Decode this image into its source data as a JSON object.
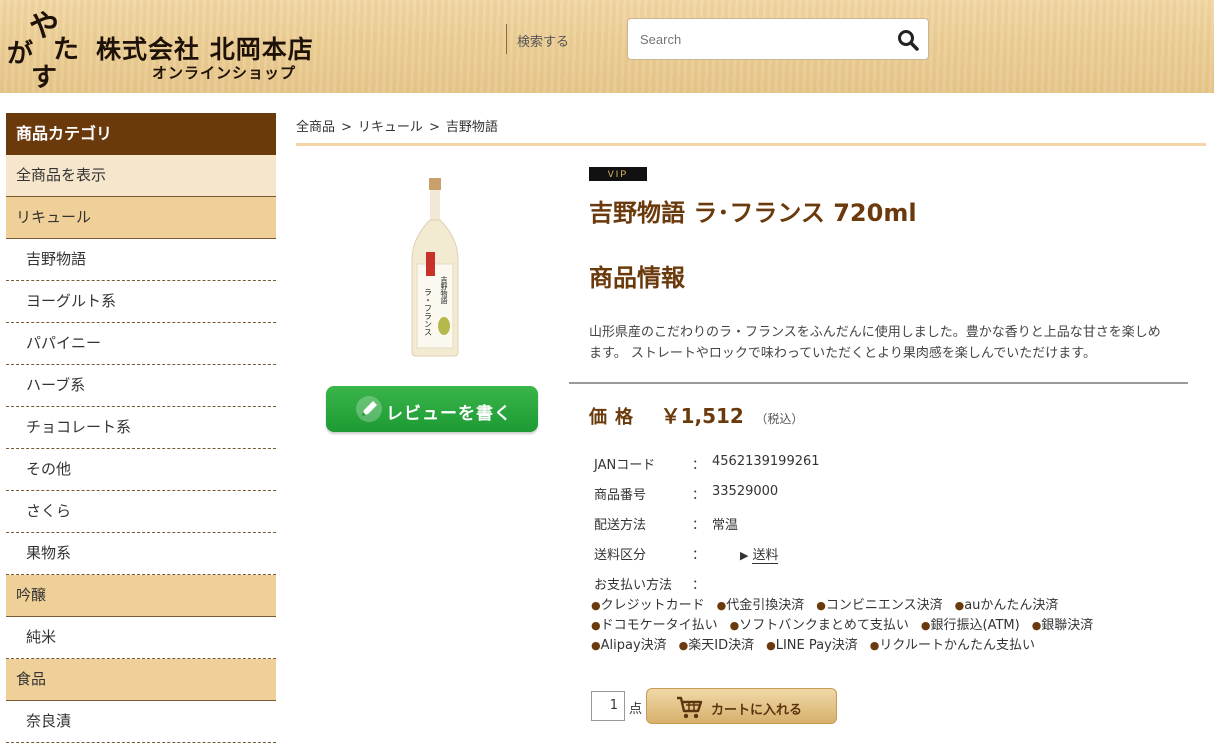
{
  "header": {
    "logo_text": "やがたす",
    "company_name": "株式会社 北岡本店",
    "company_sub": "オンラインショップ",
    "search_label": "検索する",
    "search_placeholder": "Search"
  },
  "sidebar": {
    "title": "商品カテゴリ",
    "items": [
      {
        "label": "全商品を表示",
        "type": "top"
      },
      {
        "label": "リキュール",
        "type": "cat"
      },
      {
        "label": "吉野物語",
        "type": "sub"
      },
      {
        "label": "ヨーグルト系",
        "type": "sub"
      },
      {
        "label": "パパイニー",
        "type": "sub"
      },
      {
        "label": "ハーブ系",
        "type": "sub"
      },
      {
        "label": "チョコレート系",
        "type": "sub"
      },
      {
        "label": "その他",
        "type": "sub"
      },
      {
        "label": "さくら",
        "type": "sub"
      },
      {
        "label": "果物系",
        "type": "sub"
      },
      {
        "label": "吟醸",
        "type": "cat"
      },
      {
        "label": "純米",
        "type": "sub"
      },
      {
        "label": "食品",
        "type": "cat"
      },
      {
        "label": "奈良漬",
        "type": "sub"
      }
    ]
  },
  "breadcrumb": [
    "全商品",
    "リキュール",
    "吉野物語"
  ],
  "breadcrumb_sep": ">",
  "product": {
    "badge": "VIP",
    "title": "吉野物語 ラ･フランス 720ml",
    "section_title": "商品情報",
    "description": "山形県産のこだわりのラ・フランスをふんだんに使用しました。豊かな香りと上品な甘さを楽しめます。 ストレートやロックで味わっていただくとより果肉感を楽しんでいただけます。",
    "review_button": "レビューを書く",
    "bottle_label": "ラ・フランス",
    "price_label": "価格",
    "price": "￥1,512",
    "price_tax": "（税込）",
    "specs": [
      {
        "key": "JANコード",
        "sep": "：",
        "value": "4562139199261"
      },
      {
        "key": "商品番号",
        "sep": "：",
        "value": "33529000"
      },
      {
        "key": "配送方法",
        "sep": "：",
        "value": "常温"
      },
      {
        "key": "送料区分",
        "sep": "：",
        "value": "送料"
      },
      {
        "key": "お支払い方法",
        "sep": "："
      }
    ],
    "payment_bullet": "●",
    "payments": [
      [
        "クレジットカード",
        "代金引換決済",
        "コンビニエンス決済",
        "auかんたん決済"
      ],
      [
        "ドコモケータイ払い",
        "ソフトバンクまとめて支払い",
        "銀行振込(ATM)",
        "銀聯決済"
      ],
      [
        "Alipay決済",
        "楽天ID決済",
        "LINE Pay決済",
        "リクルートかんたん支払い"
      ]
    ],
    "quantity": "1",
    "quantity_unit": "点",
    "cart_button": "カートに入れる"
  },
  "colors": {
    "brand_brown": "#6b3a0c",
    "header_wood": "#eccf97",
    "category_bg": "#f0d099",
    "review_green": "#1e9a34"
  },
  "icons": [
    "search-icon",
    "pen-icon",
    "cart-icon",
    "triangle-right-icon"
  ]
}
